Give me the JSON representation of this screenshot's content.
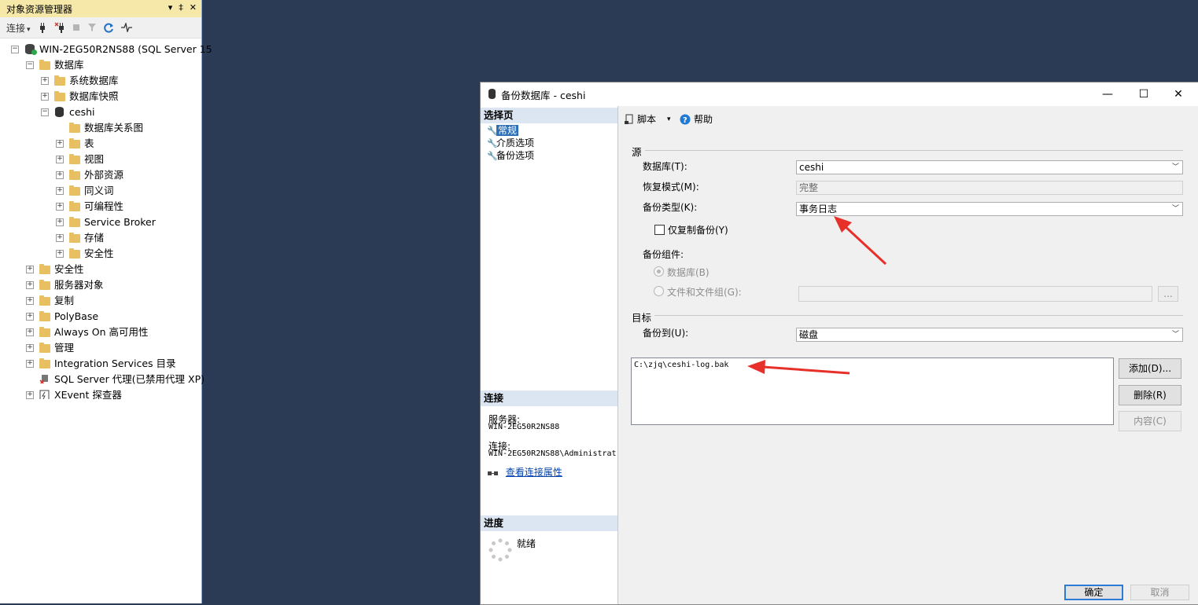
{
  "object_explorer": {
    "title": "对象资源管理器",
    "title_controls": [
      "▾",
      "‡",
      "✕"
    ],
    "toolbar": {
      "connect_label": "连接",
      "connect_arrow": "▾"
    },
    "tree": [
      {
        "label": "WIN-2EG50R2NS88 (SQL Server 15",
        "icon": "server-icon",
        "expander": "⊟"
      },
      {
        "label": "数据库",
        "icon": "folder-icon",
        "expander": "⊟"
      },
      {
        "label": "系统数据库",
        "icon": "folder-icon",
        "expander": "⊞"
      },
      {
        "label": "数据库快照",
        "icon": "folder-icon",
        "expander": "⊞"
      },
      {
        "label": "ceshi",
        "icon": "database-icon",
        "expander": "⊟"
      },
      {
        "label": "数据库关系图",
        "icon": "folder-icon",
        "expander": ""
      },
      {
        "label": "表",
        "icon": "folder-icon",
        "expander": "⊞"
      },
      {
        "label": "视图",
        "icon": "folder-icon",
        "expander": "⊞"
      },
      {
        "label": "外部资源",
        "icon": "folder-icon",
        "expander": "⊞"
      },
      {
        "label": "同义词",
        "icon": "folder-icon",
        "expander": "⊞"
      },
      {
        "label": "可编程性",
        "icon": "folder-icon",
        "expander": "⊞"
      },
      {
        "label": "Service Broker",
        "icon": "folder-icon",
        "expander": "⊞"
      },
      {
        "label": "存储",
        "icon": "folder-icon",
        "expander": "⊞"
      },
      {
        "label": "安全性",
        "icon": "folder-icon",
        "expander": "⊞"
      },
      {
        "label": "安全性",
        "icon": "folder-icon",
        "expander": "⊞"
      },
      {
        "label": "服务器对象",
        "icon": "folder-icon",
        "expander": "⊞"
      },
      {
        "label": "复制",
        "icon": "folder-icon",
        "expander": "⊞"
      },
      {
        "label": "PolyBase",
        "icon": "folder-icon",
        "expander": "⊞"
      },
      {
        "label": "Always On 高可用性",
        "icon": "folder-icon",
        "expander": "⊞"
      },
      {
        "label": "管理",
        "icon": "folder-icon",
        "expander": "⊞"
      },
      {
        "label": "Integration Services 目录",
        "icon": "folder-icon",
        "expander": "⊞"
      },
      {
        "label": "SQL Server 代理(已禁用代理 XP)",
        "icon": "agent-icon",
        "expander": ""
      },
      {
        "label": "XEvent 探查器",
        "icon": "xevent-icon",
        "expander": "⊞"
      }
    ]
  },
  "dialog": {
    "title": "备份数据库 - ceshi",
    "window_controls": {
      "minimize": "—",
      "maximize": "☐",
      "close": "✕"
    },
    "select_page": {
      "header": "选择页",
      "items": [
        "常规",
        "介质选项",
        "备份选项"
      ]
    },
    "connection": {
      "header": "连接",
      "server_label": "服务器:",
      "server_value": "WIN-2EG50R2NS88",
      "connection_label": "连接:",
      "connection_value": "WIN-2EG50R2NS88\\Administrat",
      "view_link": "查看连接属性"
    },
    "progress": {
      "header": "进度",
      "status": "就绪"
    },
    "toolbar": {
      "script_label": "脚本",
      "script_arrow": "▾",
      "help_label": "帮助"
    },
    "source": {
      "group_label": "源",
      "database_label": "数据库(T):",
      "database_value": "ceshi",
      "recovery_label": "恢复模式(M):",
      "recovery_value": "完整",
      "backup_type_label": "备份类型(K):",
      "backup_type_value": "事务日志",
      "copy_only_label": "仅复制备份(Y)",
      "component_label": "备份组件:",
      "component_database": "数据库(B)",
      "component_files": "文件和文件组(G):",
      "ellipsis": "..."
    },
    "destination": {
      "group_label": "目标",
      "backup_to_label": "备份到(U):",
      "backup_to_value": "磁盘",
      "files": [
        "C:\\zjq\\ceshi-log.bak"
      ],
      "add_button": "添加(D)...",
      "remove_button": "删除(R)",
      "contents_button": "内容(C)"
    },
    "buttons": {
      "ok": "确定",
      "cancel": "取消"
    }
  },
  "colors": {
    "desktop": "#2b3a55",
    "annotation_arrow": "#e8302a",
    "selected_page": "#2f6fb5"
  }
}
